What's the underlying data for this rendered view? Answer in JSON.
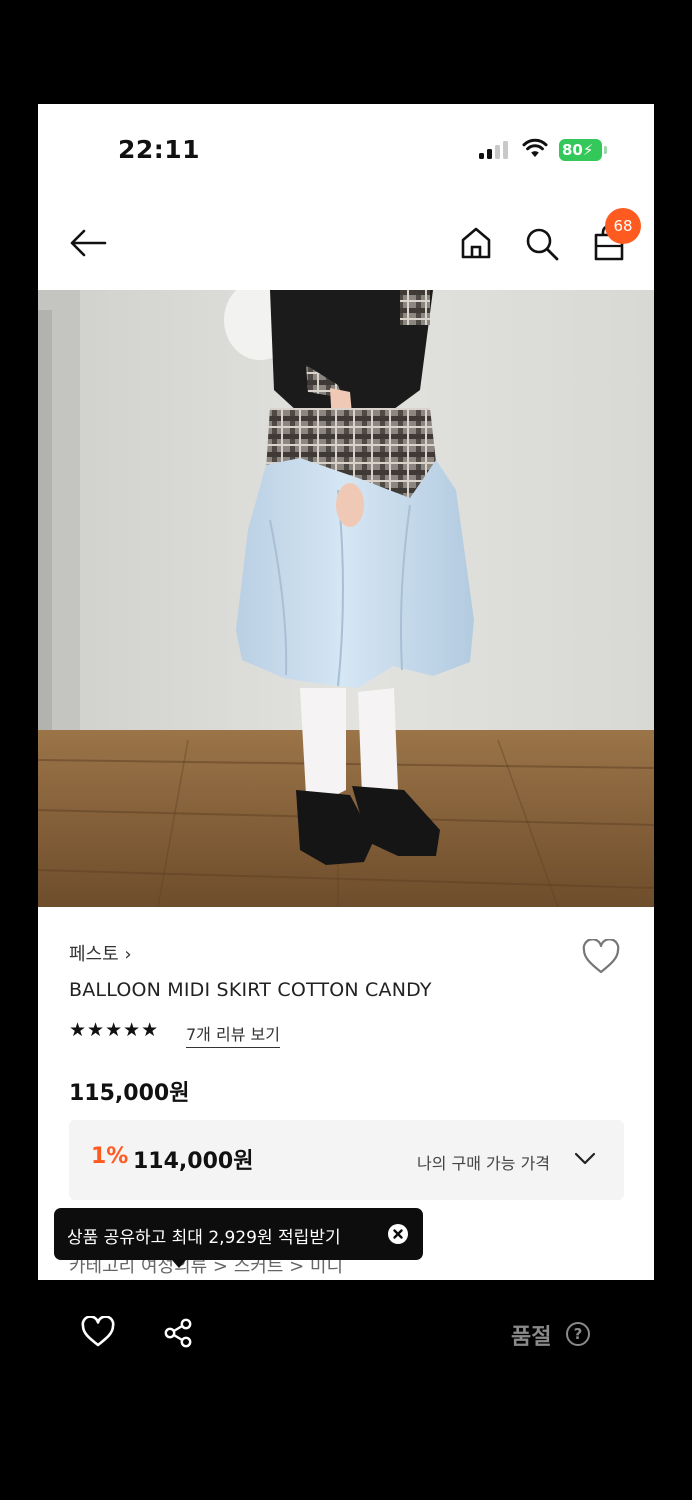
{
  "status_bar": {
    "time": "22:11",
    "battery": "80"
  },
  "header": {
    "cart_count": "68"
  },
  "product": {
    "brand": "페스토 ›",
    "name": "BALLOON MIDI SKIRT COTTON CANDY",
    "stars": "★★★★★",
    "review_link": "7개 리뷰 보기",
    "price": "115,000원",
    "discount_rate": "1%",
    "sale_price": "114,000원",
    "my_price_label": "나의 구매 가능 가격",
    "category": "카테고리     여성의류  >  스커트  >  미디"
  },
  "tooltip": {
    "text": "상품 공유하고 최대 2,929원 적립받기"
  },
  "bottom_bar": {
    "status": "품절",
    "help": "?"
  },
  "icons": [
    "back-arrow-icon",
    "home-icon",
    "search-icon",
    "shopping-bag-icon",
    "heart-icon",
    "share-icon",
    "close-icon",
    "chevron-down-icon",
    "help-icon"
  ],
  "colors": {
    "accent": "#ff5a1f",
    "battery": "#34c759"
  }
}
